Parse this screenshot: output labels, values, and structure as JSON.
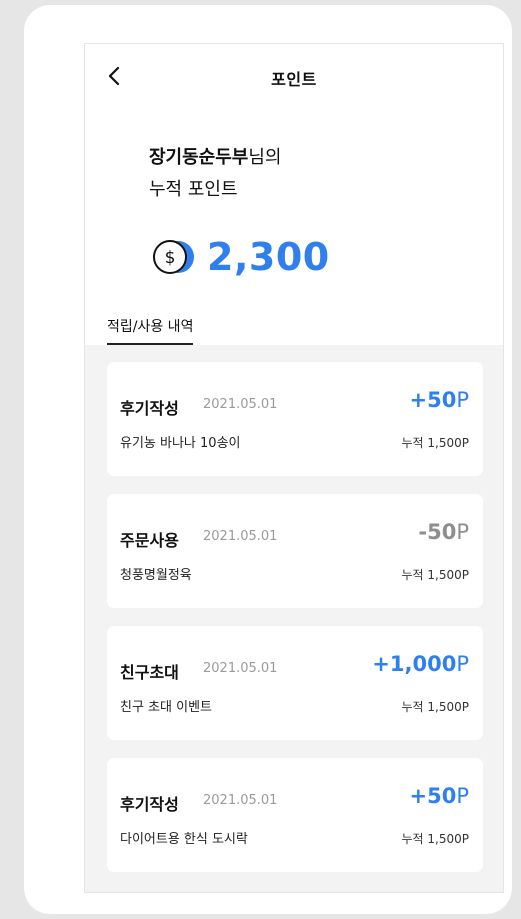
{
  "header": {
    "title": "포인트"
  },
  "summary": {
    "nickname": "장기동순두부",
    "suffix": "님의",
    "label": "누적 포인트",
    "points": "2,300"
  },
  "tab": {
    "label": "적립/사용 내역"
  },
  "history": [
    {
      "type": "후기작성",
      "date": "2021.05.01",
      "product": "유기농 바나나 10송이",
      "amount": "+50",
      "unit": "P",
      "total": "누적 1,500P"
    },
    {
      "type": "주문사용",
      "date": "2021.05.01",
      "product": "청풍명월정육",
      "amount": "-50",
      "unit": "P",
      "total": "누적 1,500P"
    },
    {
      "type": "친구초대",
      "date": "2021.05.01",
      "product": "친구 초대 이벤트",
      "amount": "+1,000",
      "unit": "P",
      "total": "누적 1,500P"
    },
    {
      "type": "후기작성",
      "date": "2021.05.01",
      "product": "다이어트용 한식 도시락",
      "amount": "+50",
      "unit": "P",
      "total": "누적 1,500P"
    }
  ],
  "colors": {
    "accent": "#2f80ed",
    "negative": "#8e8e8e",
    "list_background": "#f3f3f3"
  },
  "icons": {
    "back": "chevron-left-icon",
    "coin": "coin-icon"
  }
}
